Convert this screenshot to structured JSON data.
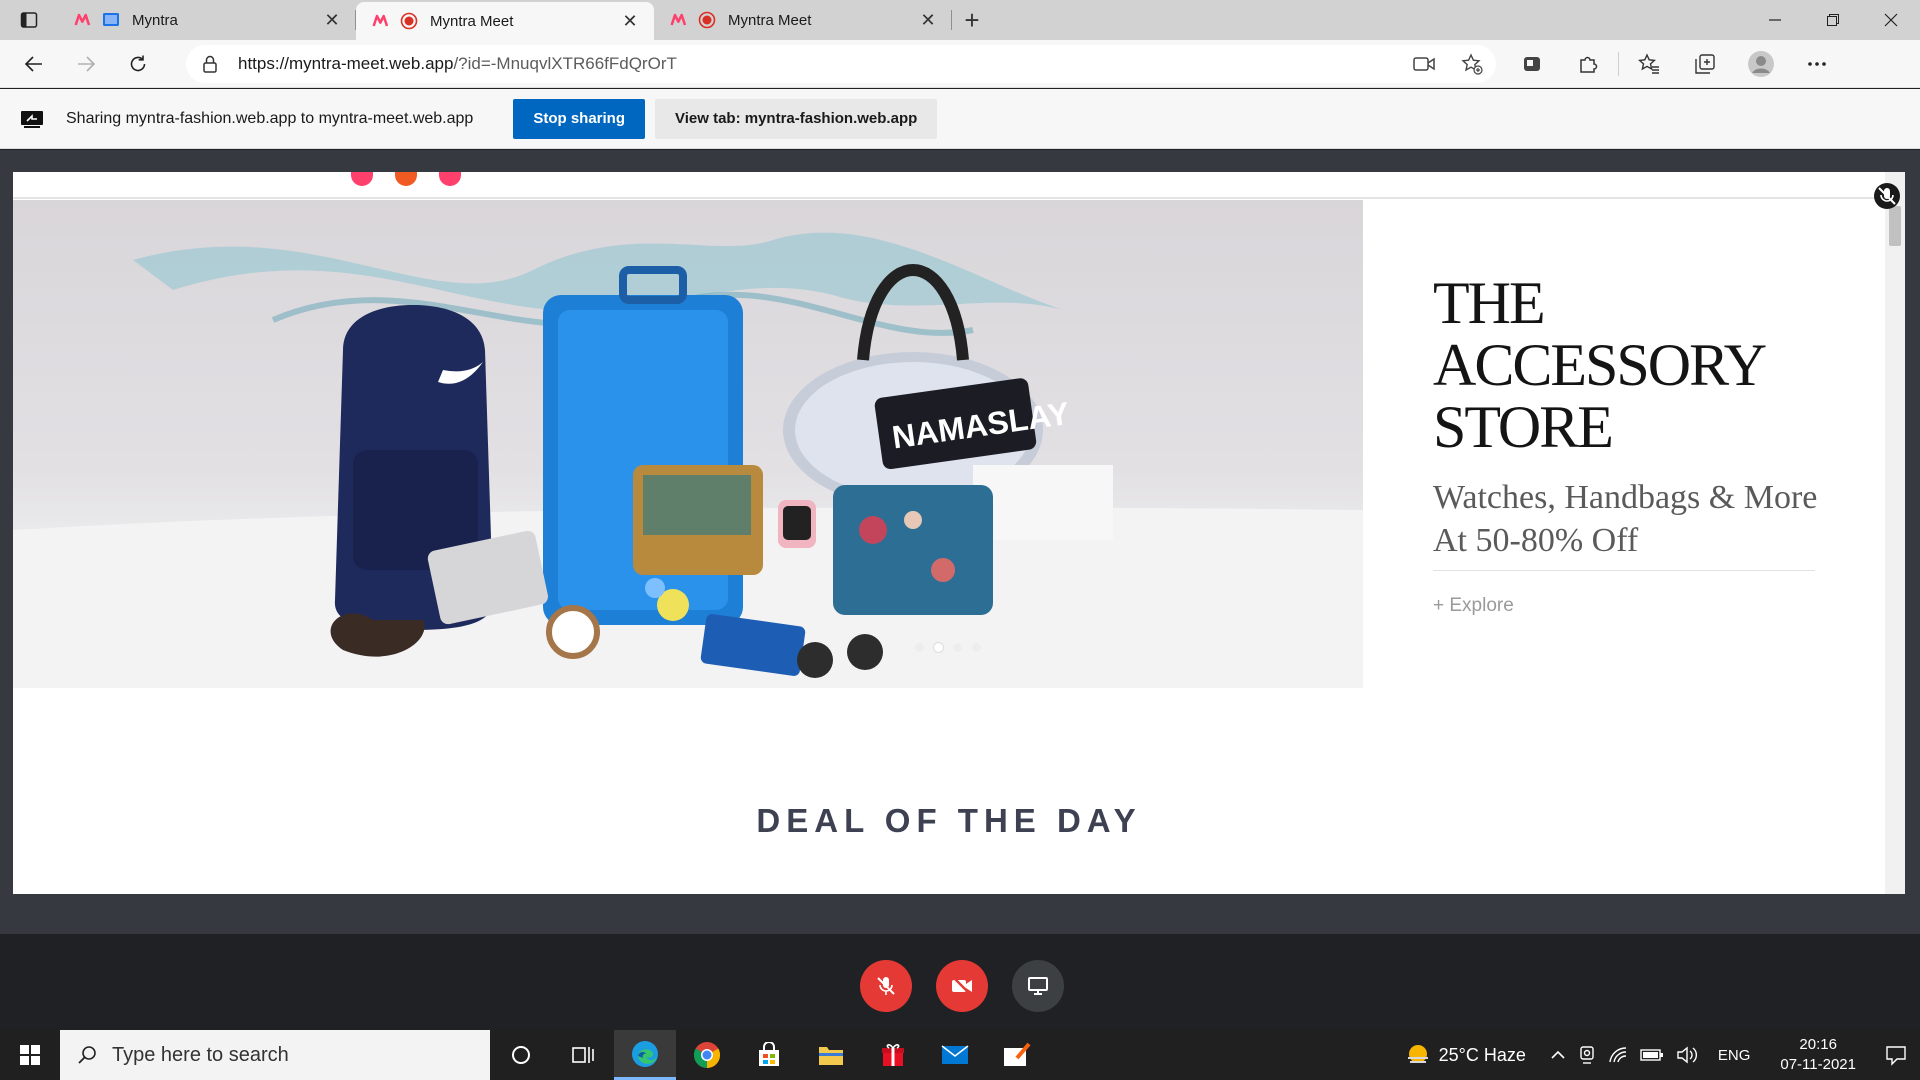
{
  "browser": {
    "tabs": [
      {
        "title": "Myntra",
        "active": false
      },
      {
        "title": "Myntra Meet",
        "active": true
      },
      {
        "title": "Myntra Meet",
        "active": false
      }
    ],
    "new_tab_label": "+",
    "url_host": "https://myntra-meet.web.app",
    "url_path": "/?id=-MnuqvlXTR66fFdQrOrT"
  },
  "share_bar": {
    "text": "Sharing myntra-fashion.web.app to myntra-meet.web.app",
    "stop_label": "Stop sharing",
    "view_label": "View tab: myntra-fashion.web.app"
  },
  "shared_page": {
    "banner": {
      "title": "THE ACCESSORY STORE",
      "subtitle": "Watches, Handbags & More At 50-80% Off",
      "link": "+ Explore",
      "bag_text": "NAMASLAY",
      "carousel_dots": 4,
      "carousel_active": 2
    },
    "section_title": "DEAL OF THE DAY"
  },
  "taskbar": {
    "search_placeholder": "Type here to search",
    "weather": "25°C  Haze",
    "language": "ENG",
    "time": "20:16",
    "date": "07-11-2021"
  },
  "colors": {
    "accent": "#0067c0",
    "call_red": "#e53935",
    "myntra_pink": "#ff3f6c",
    "myntra_orange": "#f15a22"
  }
}
